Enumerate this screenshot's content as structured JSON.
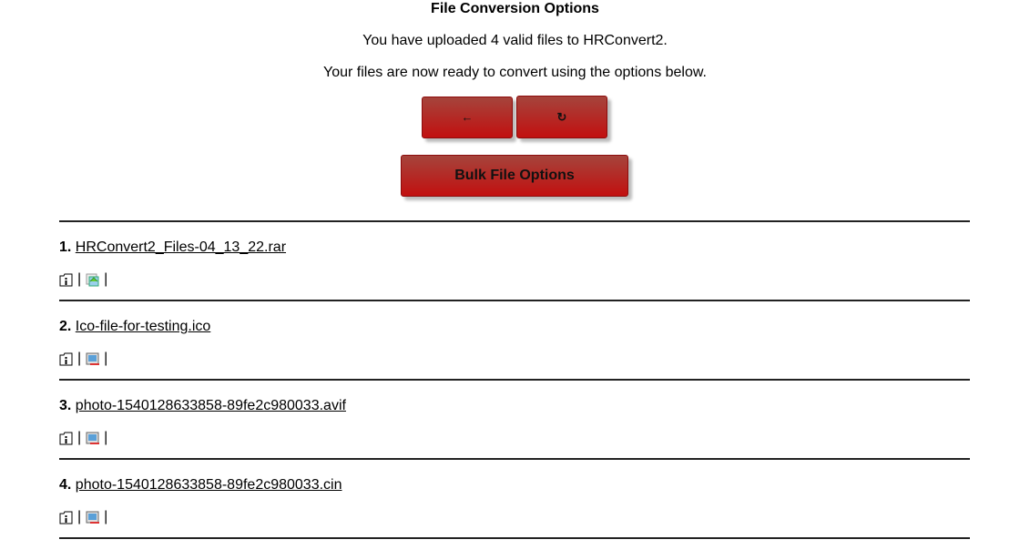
{
  "title": "File Conversion Options",
  "message1": "You have uploaded 4 valid files to HRConvert2.",
  "message2": "Your files are now ready to convert using the options below.",
  "buttons": {
    "back": "←",
    "refresh": "↻",
    "bulk": "Bulk File Options"
  },
  "separator": "|",
  "files": [
    {
      "num": "1.",
      "name": "HRConvert2_Files-04_13_22.rar",
      "type_icon": "archive-icon"
    },
    {
      "num": "2.",
      "name": "Ico-file-for-testing.ico",
      "type_icon": "image-icon"
    },
    {
      "num": "3.",
      "name": "photo-1540128633858-89fe2c980033.avif",
      "type_icon": "image-icon"
    },
    {
      "num": "4.",
      "name": "photo-1540128633858-89fe2c980033.cin",
      "type_icon": "image-icon"
    }
  ]
}
